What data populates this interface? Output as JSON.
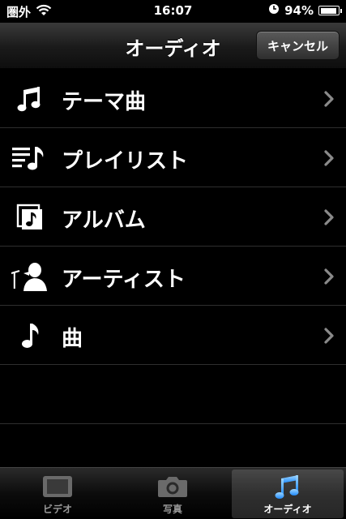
{
  "status_bar": {
    "carrier": "圏外",
    "time": "16:07",
    "battery_percent": "94%",
    "battery_level": 0.94,
    "icons": [
      "wifi-icon",
      "clock-lock-icon",
      "battery-icon"
    ]
  },
  "nav_bar": {
    "title": "オーディオ",
    "cancel_label": "キャンセル"
  },
  "list": {
    "items": [
      {
        "label": "テーマ曲",
        "icon": "double-note-icon"
      },
      {
        "label": "プレイリスト",
        "icon": "playlist-icon"
      },
      {
        "label": "アルバム",
        "icon": "album-icon"
      },
      {
        "label": "アーティスト",
        "icon": "artist-icon"
      },
      {
        "label": "曲",
        "icon": "note-icon"
      }
    ]
  },
  "tab_bar": {
    "tabs": [
      {
        "label": "ビデオ",
        "icon": "video-icon",
        "selected": false
      },
      {
        "label": "写真",
        "icon": "camera-icon",
        "selected": false
      },
      {
        "label": "オーディオ",
        "icon": "music-icon",
        "selected": true
      }
    ]
  },
  "colors": {
    "background": "#000000",
    "separator": "#2e2e2e",
    "selected_tab_icon": "#3aa6ff",
    "inactive_tab_label": "#999999"
  }
}
